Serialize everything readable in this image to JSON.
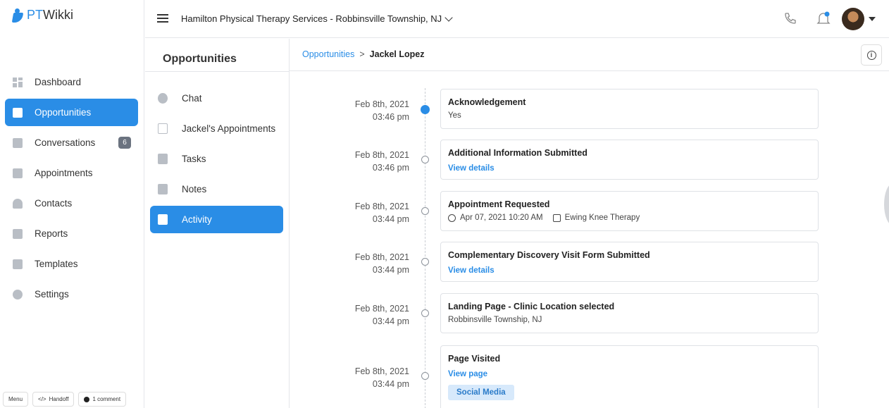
{
  "app": {
    "brand_prefix": "PT",
    "brand_suffix": "Wikki"
  },
  "sidebar": {
    "items": [
      {
        "label": "Dashboard",
        "icon": "dashboard-icon",
        "active": false
      },
      {
        "label": "Opportunities",
        "icon": "opportunities-icon",
        "active": true
      },
      {
        "label": "Conversations",
        "icon": "conversations-icon",
        "badge": "6",
        "active": false
      },
      {
        "label": "Appointments",
        "icon": "calendar-icon",
        "active": false
      },
      {
        "label": "Contacts",
        "icon": "contacts-icon",
        "active": false
      },
      {
        "label": "Reports",
        "icon": "reports-icon",
        "active": false
      },
      {
        "label": "Templates",
        "icon": "templates-icon",
        "active": false
      },
      {
        "label": "Settings",
        "icon": "gear-icon",
        "active": false
      }
    ]
  },
  "figma_bar": {
    "menu": "Menu",
    "handoff": "Handoff",
    "comment": "1 comment"
  },
  "topbar": {
    "practice": "Hamilton Physical Therapy Services - Robbinsville Township, NJ"
  },
  "midpanel": {
    "title": "Opportunities",
    "items": [
      {
        "label": "Chat",
        "icon": "chat-icon",
        "active": false
      },
      {
        "label": "Jackel's Appointments",
        "icon": "calendar-icon",
        "active": false
      },
      {
        "label": "Tasks",
        "icon": "clipboard-icon",
        "active": false
      },
      {
        "label": "Notes",
        "icon": "notes-icon",
        "active": false
      },
      {
        "label": "Activity",
        "icon": "activity-icon",
        "active": true
      }
    ]
  },
  "breadcrumb": {
    "parent": "Opportunities",
    "separator": ">",
    "current": "Jackel Lopez"
  },
  "timeline": [
    {
      "date": "Feb 8th, 2021",
      "time": "03:46 pm",
      "title": "Acknowledgement",
      "detail": "Yes",
      "filled": true
    },
    {
      "date": "Feb 8th, 2021",
      "time": "03:46 pm",
      "title": "Additional Information Submitted",
      "link": "View details"
    },
    {
      "date": "Feb 8th, 2021",
      "time": "03:44 pm",
      "title": "Appointment Requested",
      "appt_time": "Apr 07, 2021 10:20 AM",
      "appt_location": "Ewing Knee Therapy"
    },
    {
      "date": "Feb 8th, 2021",
      "time": "03:44 pm",
      "title": "Complementary Discovery Visit Form Submitted",
      "link": "View details"
    },
    {
      "date": "Feb 8th, 2021",
      "time": "03:44 pm",
      "title": "Landing Page - Clinic Location selected",
      "detail": "Robbinsville Township, NJ"
    },
    {
      "date": "Feb 8th, 2021",
      "time": "03:44 pm",
      "title": "Page Visited",
      "link": "View page",
      "tag": "Social Media"
    }
  ],
  "colors": {
    "accent": "#2a8de6",
    "tag_bg": "#d7e9fb",
    "badge_bg": "#6b7380"
  }
}
